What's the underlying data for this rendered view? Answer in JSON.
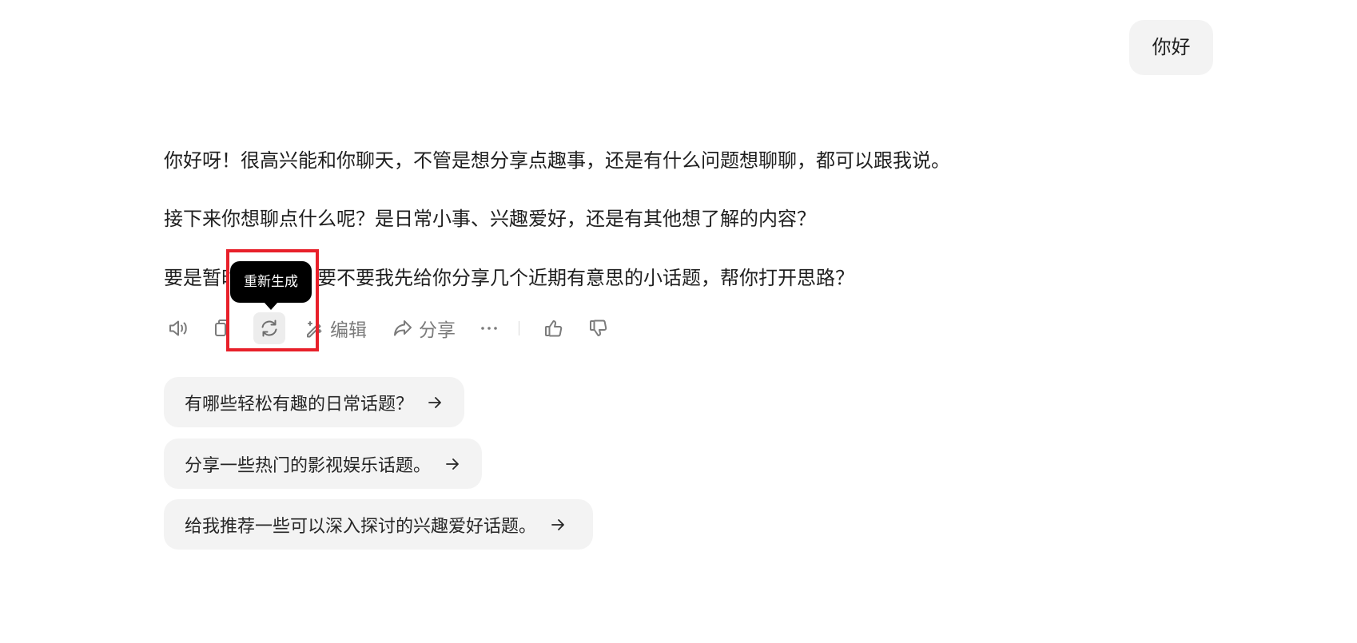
{
  "user_message": "你好",
  "assistant_reply": {
    "paragraphs": [
      "你好呀！很高兴能和你聊天，不管是想分享点趣事，还是有什么问题想聊聊，都可以跟我说。",
      "接下来你想聊点什么呢？是日常小事、兴趣爱好，还是有其他想了解的内容？",
      "要是暂时没想法，要不要我先给你分享几个近期有意思的小话题，帮你打开思路？"
    ]
  },
  "actions": {
    "speak_icon": "speaker-icon",
    "copy_icon": "copy-icon",
    "regenerate_icon": "refresh-icon",
    "edit_label": "编辑",
    "share_label": "分享",
    "more_icon": "more-dots-icon",
    "like_icon": "thumbs-up-icon",
    "dislike_icon": "thumbs-down-icon"
  },
  "tooltip": {
    "text": "重新生成"
  },
  "highlight_color": "#e8202a",
  "suggestions": [
    {
      "text": "有哪些轻松有趣的日常话题？"
    },
    {
      "text": "分享一些热门的影视娱乐话题。"
    },
    {
      "text": "给我推荐一些可以深入探讨的兴趣爱好话题。"
    }
  ]
}
